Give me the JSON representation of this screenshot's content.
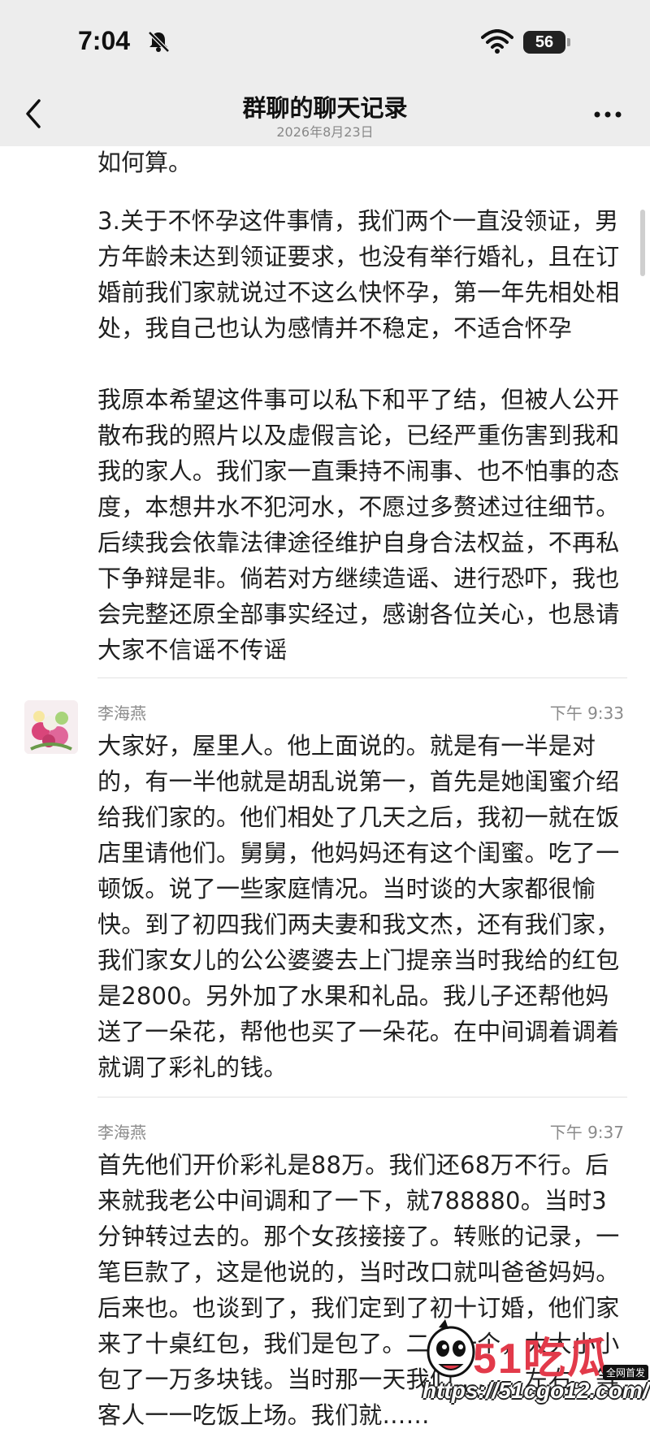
{
  "status_bar": {
    "time": "7:04",
    "battery": "56"
  },
  "nav": {
    "title": "群聊的聊天记录",
    "subtitle": "2026年8月23日"
  },
  "cut_text": "如何算。",
  "first_message": {
    "paragraphs": [
      "3.关于不怀孕这件事情，我们两个一直没领证，男方年龄未达到领证要求，也没有举行婚礼，且在订婚前我们家就说过不这么快怀孕，第一年先相处相处，我自己也认为感情并不稳定，不适合怀孕",
      "我原本希望这件事可以私下和平了结，但被人公开散布我的照片以及虚假言论，已经严重伤害到我和我的家人。我们家一直秉持不闹事、也不怕事的态度，本想井水不犯河水，不愿过多赘述过往细节。后续我会依靠法律途径维护自身合法权益，不再私下争辩是非。倘若对方继续造谣、进行恐吓，我也会完整还原全部事实经过，感谢各位关心，也恳请大家不信谣不传谣"
    ]
  },
  "messages": [
    {
      "sender": "李海燕",
      "time": "下午 9:33",
      "text": "大家好，屋里人。他上面说的。就是有一半是对的，有一半他就是胡乱说第一，首先是她闺蜜介绍给我们家的。他们相处了几天之后，我初一就在饭店里请他们。舅舅，他妈妈还有这个闺蜜。吃了一顿饭。说了一些家庭情况。当时谈的大家都很愉快。到了初四我们两夫妻和我文杰，还有我们家，我们家女儿的公公婆婆去上门提亲当时我给的红包是2800。另外加了水果和礼品。我儿子还帮他妈送了一朵花，帮他也买了一朵花。在中间调着调着就调了彩礼的钱。"
    },
    {
      "sender": "李海燕",
      "time": "下午 9:37",
      "text": "首先他们开价彩礼是88万。我们还68万不行。后来就我老公中间调和了一下，就788880。当时3分钟转过去的。那个女孩接接了。转账的记录，一笔巨款了，这是他说的，当时改口就叫爸爸妈妈。后来也。也谈到了，我们定到了初十订婚，他们家来了十桌红包，我们是包了。二十一个，大大小小包了一万多块钱。当时那一天我们……，左右。等客人一一吃饭上场。我们就……"
    }
  ],
  "watermark": {
    "brand": "51吃瓜",
    "url": "https://51cgo12.com/",
    "badge": "全网首发"
  }
}
